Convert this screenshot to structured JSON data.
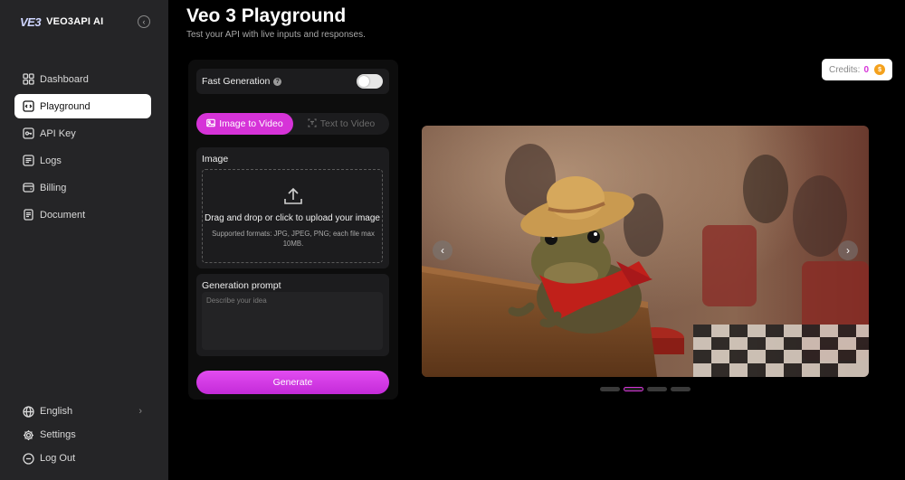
{
  "brand": {
    "logo": "VE3",
    "name": "VEO3API AI"
  },
  "sidebar": {
    "items": [
      {
        "label": "Dashboard",
        "icon": "grid-icon",
        "active": false
      },
      {
        "label": "Playground",
        "icon": "code-icon",
        "active": true
      },
      {
        "label": "API Key",
        "icon": "key-icon",
        "active": false
      },
      {
        "label": "Logs",
        "icon": "logs-icon",
        "active": false
      },
      {
        "label": "Billing",
        "icon": "wallet-icon",
        "active": false
      },
      {
        "label": "Document",
        "icon": "document-icon",
        "active": false
      }
    ],
    "bottom": [
      {
        "label": "English",
        "icon": "globe-icon"
      },
      {
        "label": "Settings",
        "icon": "gear-icon"
      },
      {
        "label": "Log Out",
        "icon": "logout-icon"
      }
    ]
  },
  "header": {
    "title": "Veo 3 Playground",
    "subtitle": "Test your API with live inputs and responses."
  },
  "form": {
    "fast_generation_label": "Fast Generation",
    "fast_generation_enabled": false,
    "tabs": [
      {
        "label": "Image to Video",
        "active": true
      },
      {
        "label": "Text to Video",
        "active": false
      }
    ],
    "image_label": "Image",
    "dropzone_text": "Drag and drop or click to upload your image",
    "dropzone_hint": "Supported formats: JPG, JPEG, PNG; each file max 10MB.",
    "prompt_label": "Generation prompt",
    "prompt_placeholder": "Describe your idea",
    "prompt_value": "",
    "generate_label": "Generate"
  },
  "credits": {
    "label": "Credits:",
    "value": "0"
  },
  "carousel": {
    "slide_count": 4,
    "active_index": 1
  },
  "colors": {
    "accent": "#d633d8",
    "sidebar_bg": "#252527",
    "card_bg": "#1c1c1e",
    "coin": "#f4a11c"
  }
}
